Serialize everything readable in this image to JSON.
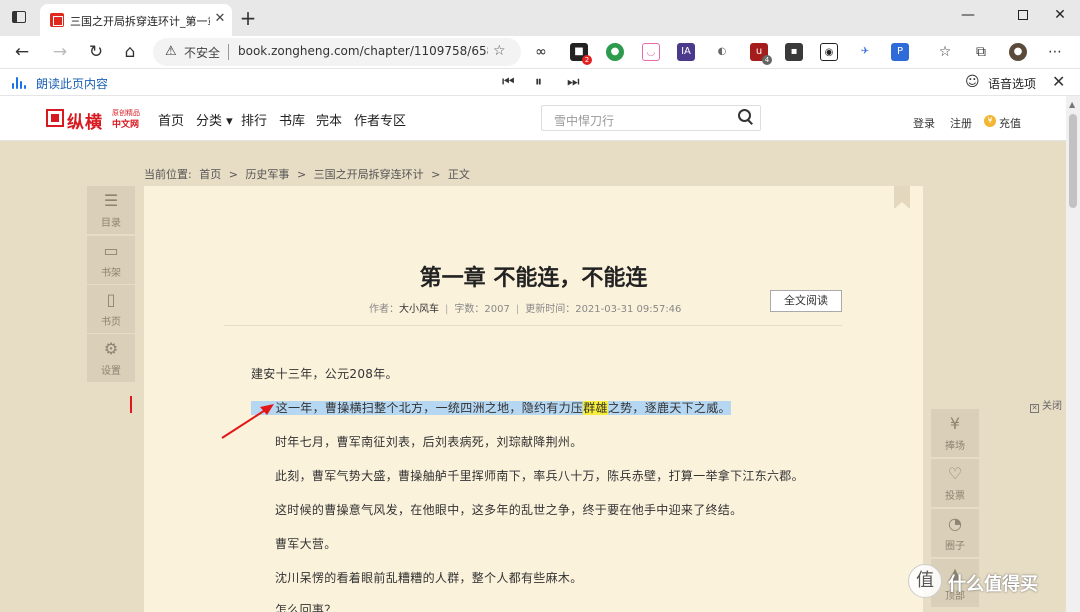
{
  "browser": {
    "tab_title": "三国之开局拆穿连环计_第一章 不",
    "new_tab": "+",
    "insecure_label": "不安全",
    "url": "book.zongheng.com/chapter/1109758/658680...",
    "ext_badges": [
      "2",
      "4"
    ],
    "read_aloud": {
      "label": "朗读此页内容",
      "voice_options": "语音选项"
    }
  },
  "site": {
    "logo_text": "纵横",
    "logo_sub1": "原创精品",
    "logo_sub2": "中文网",
    "nav": [
      "首页",
      "分类",
      "排行",
      "书库",
      "完本",
      "作者专区"
    ],
    "search_placeholder": "雪中悍刀行",
    "login": "登录",
    "register": "注册",
    "recharge": "充值"
  },
  "breadcrumb": {
    "label": "当前位置:",
    "items": [
      "首页",
      "历史军事",
      "三国之开局拆穿连环计",
      "正文"
    ],
    "sep": ">"
  },
  "left_tools": [
    "目录",
    "书架",
    "书页",
    "设置"
  ],
  "right_tools": [
    "捧场",
    "投票",
    "圈子",
    "顶部"
  ],
  "close_ad": "关闭",
  "chapter": {
    "title": "第一章 不能连，不能连",
    "author_label": "作者：",
    "author": "大小风车",
    "words_label": "字数：",
    "words": "2007",
    "updated_label": "更新时间：",
    "updated": "2021-03-31 09:57:46",
    "full_read": "全文阅读",
    "paragraphs": [
      "建安十三年，公元208年。",
      "这一年，曹操横扫整个北方，一统四洲之地，隐约有力压",
      "群雄",
      "之势，逐鹿天下之威。",
      "时年七月，曹军南征刘表，后刘表病死，刘琮献降荆州。",
      "此刻，曹军气势大盛，曹操舳舻千里挥师南下，率兵八十万，陈兵赤壁，打算一举拿下江东六郡。",
      "这时候的曹操意气风发，在他眼中，这多年的乱世之争，终于要在他手中迎来了终结。",
      "曹军大营。",
      "沈川呆愣的看着眼前乱糟糟的人群，整个人都有些麻木。",
      "怎么回事？"
    ]
  },
  "watermark": "什么值得买",
  "colors": {
    "brand_red": "#d71920",
    "page_bg": "#e7dcc4",
    "paper": "#fbf2dc",
    "selection": "#b6d7f2",
    "highlight": "#f7ee3a",
    "link_blue": "#1a5fb4"
  }
}
